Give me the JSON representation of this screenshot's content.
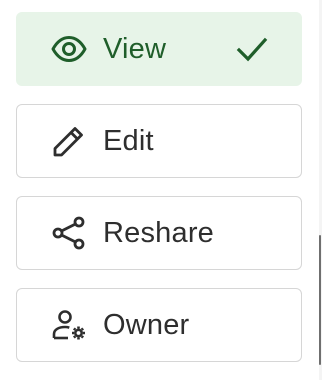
{
  "permissions": {
    "options": [
      {
        "label": "View",
        "icon": "eye-icon",
        "selected": true
      },
      {
        "label": "Edit",
        "icon": "pencil-icon",
        "selected": false
      },
      {
        "label": "Reshare",
        "icon": "share-icon",
        "selected": false
      },
      {
        "label": "Owner",
        "icon": "person-gear-icon",
        "selected": false
      }
    ],
    "selected_indicator_icon": "checkmark-icon"
  },
  "colors": {
    "selected_background": "#e7f4e8",
    "selected_foreground": "#1f5e2a",
    "text": "#2e2e2e",
    "border": "#d6d6d6"
  }
}
